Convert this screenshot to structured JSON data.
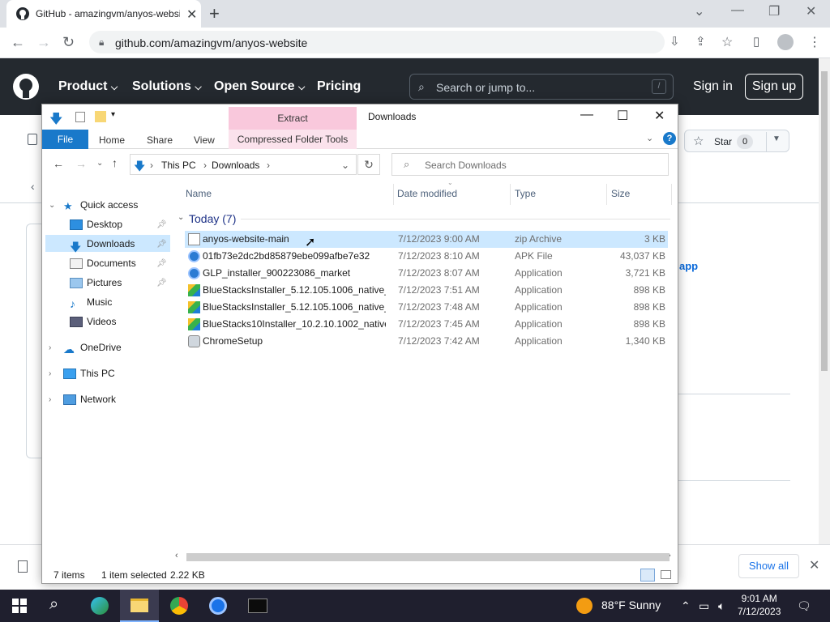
{
  "browser": {
    "tab_title": "GitHub - amazingvm/anyos-website",
    "url": "github.com/amazingvm/anyos-website"
  },
  "github": {
    "nav": [
      "Product",
      "Solutions",
      "Open Source",
      "Pricing"
    ],
    "search_placeholder": "Search or jump to...",
    "search_shortcut": "/",
    "sign_in": "Sign in",
    "sign_up": "Sign up",
    "star_label": "Star",
    "star_count": "0",
    "partial_link": "app"
  },
  "downloads_bar": {
    "show_all": "Show all"
  },
  "explorer": {
    "extract_tab": "Extract",
    "window_title": "Downloads",
    "ribbon_tabs": [
      "File",
      "Home",
      "Share",
      "View",
      "Compressed Folder Tools"
    ],
    "breadcrumb": [
      "This PC",
      "Downloads"
    ],
    "search_placeholder": "Search Downloads",
    "nav": {
      "quick_access": "Quick access",
      "desktop": "Desktop",
      "downloads": "Downloads",
      "documents": "Documents",
      "pictures": "Pictures",
      "music": "Music",
      "videos": "Videos",
      "onedrive": "OneDrive",
      "this_pc": "This PC",
      "network": "Network"
    },
    "columns": [
      "Name",
      "Date modified",
      "Type",
      "Size"
    ],
    "group": "Today (7)",
    "files": [
      {
        "name": "anyos-website-main",
        "date": "7/12/2023 9:00 AM",
        "type": "zip Archive",
        "size": "3 KB",
        "icon": "zip-icon"
      },
      {
        "name": "01fb73e2dc2bd85879ebe099afbe7e32",
        "date": "7/12/2023 8:10 AM",
        "type": "APK File",
        "size": "43,037 KB",
        "icon": "apk-icon"
      },
      {
        "name": "GLP_installer_900223086_market",
        "date": "7/12/2023 8:07 AM",
        "type": "Application",
        "size": "3,721 KB",
        "icon": "app-icon"
      },
      {
        "name": "BlueStacksInstaller_5.12.105.1006_native_...",
        "date": "7/12/2023 7:51 AM",
        "type": "Application",
        "size": "898 KB",
        "icon": "bluestacks-icon"
      },
      {
        "name": "BlueStacksInstaller_5.12.105.1006_native_...",
        "date": "7/12/2023 7:48 AM",
        "type": "Application",
        "size": "898 KB",
        "icon": "bluestacks-icon"
      },
      {
        "name": "BlueStacks10Installer_10.2.10.1002_native...",
        "date": "7/12/2023 7:45 AM",
        "type": "Application",
        "size": "898 KB",
        "icon": "bluestacks-icon"
      },
      {
        "name": "ChromeSetup",
        "date": "7/12/2023 7:42 AM",
        "type": "Application",
        "size": "1,340 KB",
        "icon": "setup-icon"
      }
    ],
    "status": {
      "items": "7 items",
      "selected": "1 item selected",
      "size": "2.22 KB"
    }
  },
  "taskbar": {
    "weather": "88°F  Sunny",
    "time": "9:01 AM",
    "date": "7/12/2023"
  }
}
